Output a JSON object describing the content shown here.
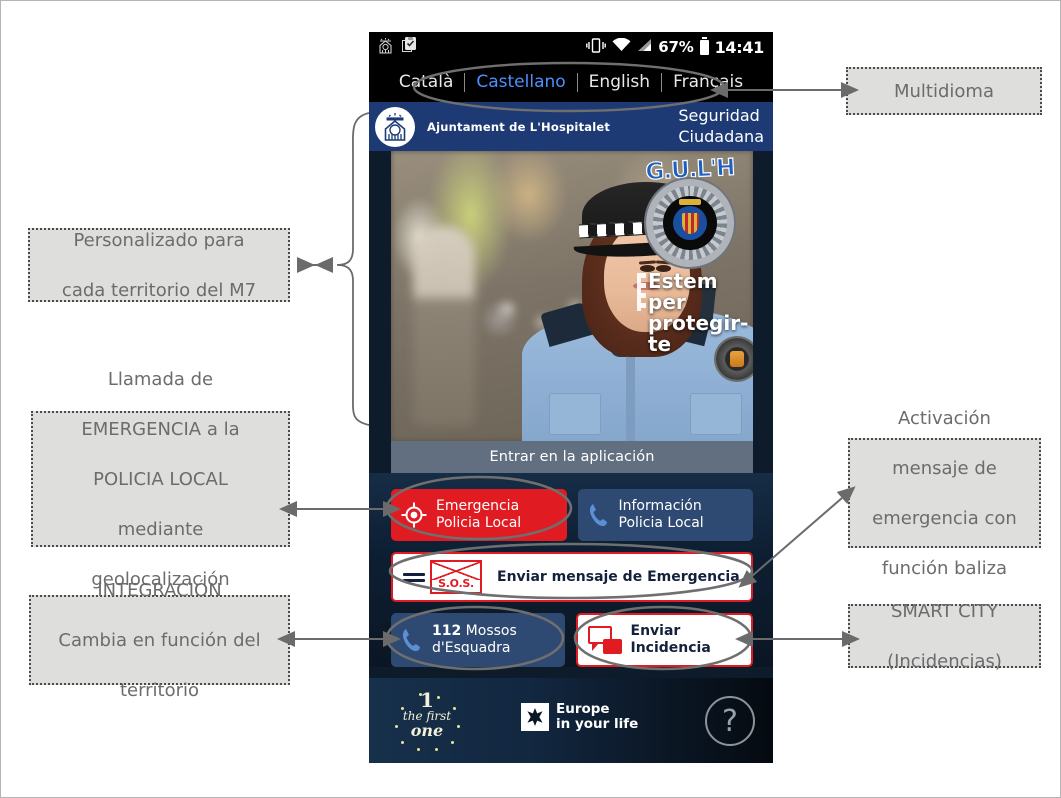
{
  "statusbar": {
    "icons": [
      "crest-notification-icon",
      "clipboard-check-icon",
      "vibrate-icon",
      "wifi-icon",
      "signal-icon"
    ],
    "battery_percent": "67%",
    "time": "14:41"
  },
  "languages": [
    {
      "label": "Català",
      "active": false
    },
    {
      "label": "Castellano",
      "active": true
    },
    {
      "label": "English",
      "active": false
    },
    {
      "label": "Français",
      "active": false
    }
  ],
  "appheader": {
    "town": "Ajuntament de L'Hospitalet",
    "section_line1": "Seguridad",
    "section_line2": "Ciudadana",
    "crest_icon": "hospitalet-crest-icon"
  },
  "hero": {
    "badge_title": "G.U.L'H",
    "badge_ring_text": "Guàrdia Urbana L'Hospitalet",
    "slogan_line1": "Estem per",
    "slogan_line2": "protegir-te",
    "photo_alt": "police-officer-photo"
  },
  "enter_button": "Entrar en la aplicación",
  "buttons": {
    "emergencia": {
      "line1": "Emergencia",
      "line2": "Policia Local",
      "icon": "geolocation-target-icon",
      "color": "#e11b22"
    },
    "informacion": {
      "line1": "Información",
      "line2": "Policia Local",
      "icon": "phone-icon",
      "color": "#2f4a72"
    },
    "sos": {
      "label": "Enviar mensaje de Emergencia",
      "icon": "sos-envelope-icon",
      "sos_text": "S.O.S.",
      "color": "#ffffff"
    },
    "mossos": {
      "number": "112",
      "line1_rest": " Mossos",
      "line2": "d'Esquadra",
      "icon": "phone-icon",
      "color": "#2f4a72"
    },
    "incidencia": {
      "line1": "Enviar",
      "line2": "Incidencia",
      "icon": "chat-bubbles-icon",
      "color": "#ffffff"
    }
  },
  "footer": {
    "first_one": {
      "num": "1",
      "the_first": "the first",
      "one": "one"
    },
    "europe": {
      "line1": "Europe",
      "line2": "in your life",
      "icon": "europe-star-icon"
    },
    "help": "?"
  },
  "annotations": {
    "multidioma": "Multidioma",
    "personalizado": "Personalizado para cada territorio del M7",
    "llamada": "Llamada de EMERGENCIA a la POLICIA LOCAL mediante geolocalización",
    "activacion": "Activación mensaje de emergencia con función baliza",
    "integracion": "INTEGRACIÓN Cambia en función del territorio",
    "smartcity": "SMART CITY (Incidencias)"
  },
  "annotation_lines": {
    "multidioma": [
      "Multidioma"
    ],
    "personalizado": [
      "Personalizado para",
      "cada territorio del M7"
    ],
    "llamada": [
      "Llamada de",
      "EMERGENCIA a la",
      "POLICIA LOCAL",
      "mediante",
      "geolocalización"
    ],
    "activacion": [
      "Activación",
      "mensaje de",
      "emergencia con",
      "función baliza"
    ],
    "integracion": [
      "INTEGRACIÓN",
      "Cambia en función del",
      "territorio"
    ],
    "smartcity": [
      "SMART CITY",
      "(Incidencias)"
    ]
  },
  "colors": {
    "annotation_fill": "#dededd",
    "annotation_border": "#4a4a4a",
    "annotation_text": "#6c6c6c",
    "app_header_blue": "#1e3a75",
    "emergency_red": "#e11b22",
    "info_blue": "#2f4a72",
    "phone_bg": "#0d1b2a",
    "callout_stroke": "#6f6f6f"
  }
}
